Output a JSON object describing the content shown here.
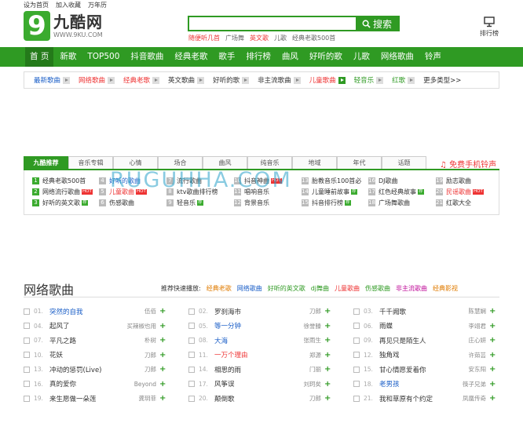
{
  "top_links": [
    "设为首页",
    "加入收藏",
    "万年历"
  ],
  "logo": {
    "mark": "9",
    "cn": "九酷网",
    "en": "WWW.9KU.COM"
  },
  "search": {
    "placeholder": "",
    "button": "搜索"
  },
  "hot_words": [
    {
      "text": "随便听几首",
      "red": true
    },
    {
      "text": "广场舞",
      "red": false
    },
    {
      "text": "英文歌",
      "red": true
    },
    {
      "text": "儿歌",
      "red": false
    },
    {
      "text": "经典老歌500首",
      "red": false
    }
  ],
  "rank": {
    "label": "排行榜"
  },
  "nav": [
    "首 页",
    "新歌",
    "TOP500",
    "抖音歌曲",
    "经典老歌",
    "歌手",
    "排行榜",
    "曲风",
    "好听的歌",
    "儿歌",
    "网络歌曲",
    "铃声"
  ],
  "subnav": [
    {
      "label": "最新歌曲",
      "color": "#1a5ec7",
      "green": false
    },
    {
      "label": "网络歌曲",
      "color": "#e33",
      "green": false
    },
    {
      "label": "经典老歌",
      "color": "#e33",
      "green": false
    },
    {
      "label": "英文歌曲",
      "color": "#333",
      "green": false
    },
    {
      "label": "好听的歌",
      "color": "#333",
      "green": false
    },
    {
      "label": "非主流歌曲",
      "color": "#333",
      "green": false
    },
    {
      "label": "儿童歌曲",
      "color": "#e33",
      "green": true
    },
    {
      "label": "轻音乐",
      "color": "#2f9a23",
      "green": false
    },
    {
      "label": "红歌",
      "color": "#2f9a23",
      "green": false
    }
  ],
  "subnav_more": "更多类型>>",
  "tabs": [
    "九酷推荐",
    "音乐专辑",
    "心情",
    "场合",
    "曲风",
    "纯音乐",
    "地域",
    "年代",
    "话题"
  ],
  "free_ringtone": "免费手机铃声",
  "watermark": "RUGUHHA.COM",
  "tag_rows": [
    [
      {
        "n": "1",
        "t": "经典老歌500首",
        "b": "",
        "c": ""
      },
      {
        "n": "4",
        "t": "好听的歌曲",
        "b": "",
        "c": "blue"
      },
      {
        "n": "7",
        "t": "流行歌曲",
        "b": "",
        "c": ""
      },
      {
        "n": "10",
        "t": "抖音神曲",
        "b": "hot",
        "c": ""
      },
      {
        "n": "13",
        "t": "胎教音乐100首必",
        "b": "",
        "c": ""
      },
      {
        "n": "16",
        "t": "DJ歌曲",
        "b": "",
        "c": ""
      },
      {
        "n": "19",
        "t": "励志歌曲",
        "b": "",
        "c": ""
      }
    ],
    [
      {
        "n": "2",
        "t": "网络流行歌曲",
        "b": "hot",
        "c": ""
      },
      {
        "n": "5",
        "t": "儿童歌曲",
        "b": "hot",
        "c": "red"
      },
      {
        "n": "8",
        "t": "ktv歌曲排行榜",
        "b": "",
        "c": ""
      },
      {
        "n": "11",
        "t": "唱响音乐",
        "b": "",
        "c": ""
      },
      {
        "n": "14",
        "t": "儿童睡前故事",
        "b": "g",
        "c": ""
      },
      {
        "n": "17",
        "t": "红色经典故事",
        "b": "g",
        "c": ""
      },
      {
        "n": "20",
        "t": "民谣歌曲",
        "b": "hot",
        "c": "red"
      }
    ],
    [
      {
        "n": "3",
        "t": "好听的英文歌",
        "b": "g",
        "c": ""
      },
      {
        "n": "6",
        "t": "伤感歌曲",
        "b": "",
        "c": ""
      },
      {
        "n": "9",
        "t": "轻音乐",
        "b": "g",
        "c": ""
      },
      {
        "n": "12",
        "t": "背景音乐",
        "b": "",
        "c": ""
      },
      {
        "n": "15",
        "t": "抖音排行榜",
        "b": "g",
        "c": ""
      },
      {
        "n": "18",
        "t": "广场舞歌曲",
        "b": "",
        "c": ""
      },
      {
        "n": "21",
        "t": "红歌大全",
        "b": "",
        "c": ""
      }
    ]
  ],
  "section": {
    "title": "网络歌曲",
    "quick_label": "推荐快速播放:",
    "quick": [
      {
        "t": "经典老歌",
        "c": "#e07b00"
      },
      {
        "t": "网络歌曲",
        "c": "#1a5ec7"
      },
      {
        "t": "好听的英文歌",
        "c": "#2f9a23"
      },
      {
        "t": "dj舞曲",
        "c": "#2f9a23"
      },
      {
        "t": "儿童歌曲",
        "c": "#e33"
      },
      {
        "t": "伤感歌曲",
        "c": "#2f9a23"
      },
      {
        "t": "非主流歌曲",
        "c": "#c0109a"
      },
      {
        "t": "经典影视",
        "c": "#e07b00"
      }
    ]
  },
  "songs": [
    [
      {
        "n": "01.",
        "t": "突然的自我",
        "a": "伍佰",
        "c": "blue"
      },
      {
        "n": "04.",
        "t": "起风了",
        "a": "买辣椒也用",
        "c": ""
      },
      {
        "n": "07.",
        "t": "平凡之路",
        "a": "朴树",
        "c": ""
      },
      {
        "n": "10.",
        "t": "花妖",
        "a": "刀郎",
        "c": ""
      },
      {
        "n": "13.",
        "t": "冲动的惩罚(Live)",
        "a": "刀郎",
        "c": ""
      },
      {
        "n": "16.",
        "t": "真的爱你",
        "a": "Beyond",
        "c": ""
      },
      {
        "n": "19.",
        "t": "来生愿做一朵莲",
        "a": "龚玥菲",
        "c": ""
      }
    ],
    [
      {
        "n": "02.",
        "t": "罗刹海市",
        "a": "刀郎",
        "c": ""
      },
      {
        "n": "05.",
        "t": "等一分钟",
        "a": "徐誉滕",
        "c": "blue"
      },
      {
        "n": "08.",
        "t": "大海",
        "a": "张雨生",
        "c": "blue"
      },
      {
        "n": "11.",
        "t": "一万个理由",
        "a": "郑源",
        "c": "red"
      },
      {
        "n": "14.",
        "t": "相思的雨",
        "a": "门丽",
        "c": ""
      },
      {
        "n": "17.",
        "t": "风筝误",
        "a": "刘珂矣",
        "c": ""
      },
      {
        "n": "20.",
        "t": "颠倒歌",
        "a": "刀郎",
        "c": ""
      }
    ],
    [
      {
        "n": "03.",
        "t": "千千阙歌",
        "a": "陈慧娴",
        "c": ""
      },
      {
        "n": "06.",
        "t": "雨蝶",
        "a": "李翊君",
        "c": ""
      },
      {
        "n": "09.",
        "t": "再见只是陌生人",
        "a": "庄心妍",
        "c": ""
      },
      {
        "n": "12.",
        "t": "独角戏",
        "a": "许茹芸",
        "c": ""
      },
      {
        "n": "15.",
        "t": "甘心情愿爱着你",
        "a": "安东阳",
        "c": ""
      },
      {
        "n": "18.",
        "t": "老男孩",
        "a": "筷子兄弟",
        "c": "blue"
      },
      {
        "n": "21.",
        "t": "我和草原有个约定",
        "a": "凤凰传奇",
        "c": ""
      }
    ]
  ]
}
